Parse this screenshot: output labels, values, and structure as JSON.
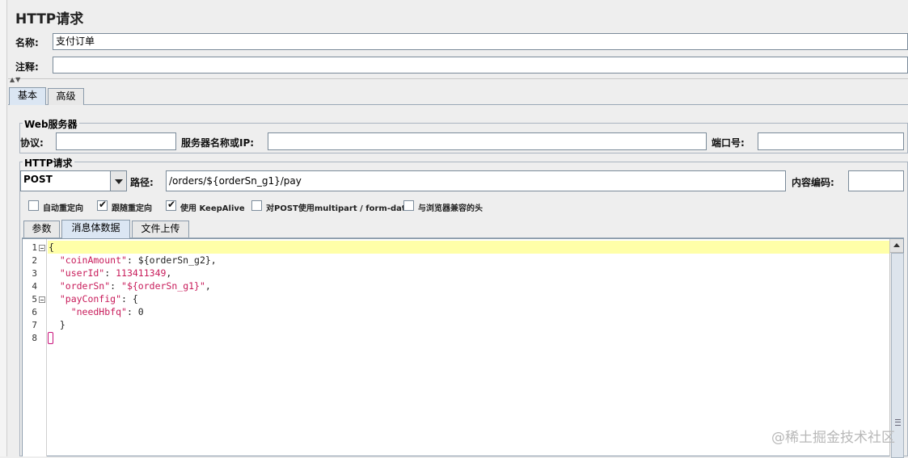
{
  "window": {
    "title": "HTTP请求"
  },
  "name_row": {
    "label": "名称:",
    "value": "支付订单"
  },
  "comment_row": {
    "label": "注释:",
    "value": ""
  },
  "main_tabs": [
    {
      "label": "基本",
      "active": true
    },
    {
      "label": "高级",
      "active": false
    }
  ],
  "web_server": {
    "group_title": "Web服务器",
    "protocol_label": "协议:",
    "protocol_value": "",
    "server_label": "服务器名称或IP:",
    "server_value": "",
    "port_label": "端口号:",
    "port_value": ""
  },
  "http_request": {
    "group_title": "HTTP请求",
    "method": "POST",
    "path_label": "路径:",
    "path_value": "/orders/${orderSn_g1}/pay",
    "encoding_label": "内容编码:",
    "encoding_value": ""
  },
  "options": [
    {
      "label": "自动重定向",
      "checked": false
    },
    {
      "label": "跟随重定向",
      "checked": true
    },
    {
      "label": "使用 KeepAlive",
      "checked": true
    },
    {
      "label": "对POST使用multipart / form-data",
      "checked": false
    },
    {
      "label": "与浏览器兼容的头",
      "checked": false
    }
  ],
  "body_tabs": [
    {
      "label": "参数",
      "active": false
    },
    {
      "label": "消息体数据",
      "active": true
    },
    {
      "label": "文件上传",
      "active": false
    }
  ],
  "editor": {
    "line_numbers": [
      "1",
      "2",
      "3",
      "4",
      "5",
      "6",
      "7",
      "8"
    ],
    "lines": [
      {
        "parts": [
          [
            "t",
            "{"
          ]
        ]
      },
      {
        "parts": [
          [
            "k",
            "  \"coinAmount\""
          ],
          [
            "t",
            ": ${orderSn_g2},"
          ]
        ]
      },
      {
        "parts": [
          [
            "k",
            "  \"userId\""
          ],
          [
            "t",
            ": "
          ],
          [
            "n",
            "113411349"
          ],
          [
            "t",
            ","
          ]
        ]
      },
      {
        "parts": [
          [
            "k",
            "  \"orderSn\""
          ],
          [
            "t",
            ": "
          ],
          [
            "k",
            "\"${orderSn_g1}\""
          ],
          [
            "t",
            ","
          ]
        ]
      },
      {
        "parts": [
          [
            "k",
            "  \"payConfig\""
          ],
          [
            "t",
            ": {"
          ]
        ]
      },
      {
        "parts": [
          [
            "k",
            "    \"needHbfq\""
          ],
          [
            "t",
            ": 0"
          ]
        ]
      },
      {
        "parts": [
          [
            "t",
            "  }"
          ]
        ]
      },
      {
        "parts": [
          [
            "t",
            ""
          ]
        ]
      }
    ]
  },
  "colors": {
    "key": "#c81b5a",
    "text": "#222222",
    "current_line": "#ffffa8"
  },
  "watermark": "@稀土掘金技术社区"
}
